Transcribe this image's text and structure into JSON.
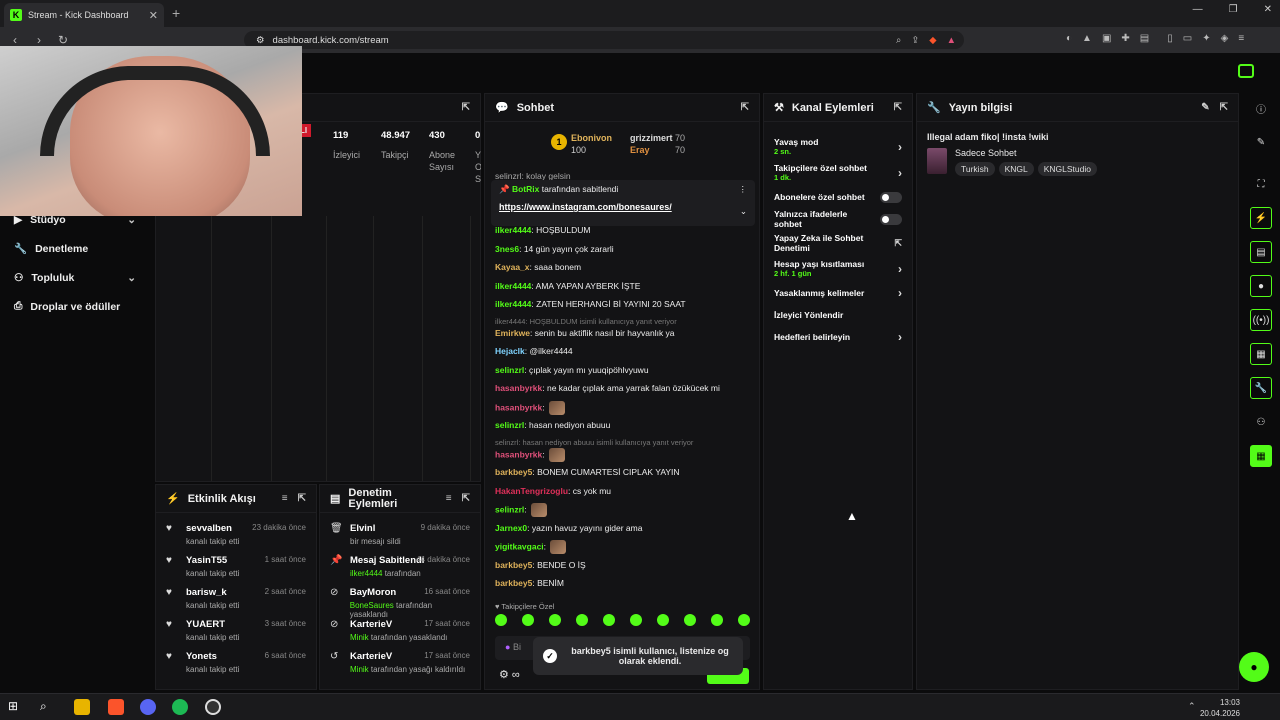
{
  "browser": {
    "tab_title": "Stream - Kick Dashboard",
    "url": "dashboard.kick.com/stream",
    "new_tab": "+",
    "close": "✕",
    "minimize": "—",
    "maximize": "❐"
  },
  "leftnav": {
    "items": [
      {
        "label": "Stüdyo",
        "icon": "video-icon",
        "chevron": "⌄"
      },
      {
        "label": "Denetleme",
        "icon": "wrench-icon"
      },
      {
        "label": "Topluluk",
        "icon": "people-icon",
        "chevron": "⌄"
      },
      {
        "label": "Droplar ve ödüller",
        "icon": "gift-icon"
      }
    ]
  },
  "stats": {
    "live_badge": "LI",
    "cols": [
      {
        "value": "119",
        "label": "İzleyici"
      },
      {
        "value": "48.947",
        "label": "Takipçi"
      },
      {
        "value": "430",
        "label": "Abone Sayısı"
      },
      {
        "value": "0",
        "label": "Y O S"
      }
    ]
  },
  "activity": {
    "title": "Etkinlik Akışı",
    "items": [
      {
        "name": "sevvalben",
        "sub": "kanalı takip etti",
        "time": "23 dakika önce"
      },
      {
        "name": "YasinT55",
        "sub": "kanalı takip etti",
        "time": "1 saat önce"
      },
      {
        "name": "barisw_k",
        "sub": "kanalı takip etti",
        "time": "2 saat önce"
      },
      {
        "name": "YUAERT",
        "sub": "kanalı takip etti",
        "time": "3 saat önce"
      },
      {
        "name": "Yonets",
        "sub": "kanalı takip etti",
        "time": "6 saat önce"
      }
    ]
  },
  "modactions": {
    "title": "Denetim Eylemleri",
    "items": [
      {
        "name": "Elvinl",
        "sub_user": "",
        "sub": "bir mesajı sildi",
        "time": "9 dakika önce",
        "icon": "🗑"
      },
      {
        "name": "Mesaj Sabitlendi",
        "sub_user": "ilker4444",
        "sub": "tarafından",
        "time": "44 dakika önce",
        "icon": "📌"
      },
      {
        "name": "BayMoron",
        "sub_user": "BoneSaures",
        "sub": "tarafından yasaklandı",
        "time": "16 saat önce",
        "icon": "⊘"
      },
      {
        "name": "KarterieV",
        "sub_user": "Minik",
        "sub": "tarafından yasaklandı",
        "time": "17 saat önce",
        "icon": "⊘"
      },
      {
        "name": "KarterieV",
        "sub_user": "Minik",
        "sub": "tarafından yasağı kaldırıldı",
        "time": "17 saat önce",
        "icon": "↺"
      }
    ]
  },
  "chat": {
    "title": "Sohbet",
    "top": {
      "user1": "Ebonivon",
      "user1_val": "100",
      "user2": "grizzimert",
      "user2_val": "70",
      "user3": "Eray",
      "user3_val": "70"
    },
    "partial_msg": "selinzrl: kolay gelsin",
    "pinned": {
      "by": "BotRix",
      "suffix": "tarafından sabitlendi",
      "link": "https://www.instagram.com/bonesaures/"
    },
    "messages": [
      {
        "user": "ilker4444",
        "color": "#53fc18",
        "text": ": HOŞBULDUM"
      },
      {
        "user": "3nes6",
        "color": "#53fc18",
        "text": ": 14 gün yayın çok zararli"
      },
      {
        "user": "Kayaa_x",
        "color": "#e0b35b",
        "text": ": saaa bonem"
      },
      {
        "user": "ilker4444",
        "color": "#53fc18",
        "text": ": AMA YAPAN AYBERK İŞTE"
      },
      {
        "user": "ilker4444",
        "color": "#53fc18",
        "text": ": ZATEN HERHANGİ Bİ YAYINI 20 SAAT"
      },
      {
        "reply": "ilker4444: HOŞBULDUM isimli kullanıcıya yanıt veriyor",
        "user": "Emirkwe",
        "color": "#e0b35b",
        "text": ": senin bu aktiflik nasıl bir hayvanlık ya"
      },
      {
        "user": "Hejaclk",
        "color": "#7fd3ff",
        "text": ": @ilker4444"
      },
      {
        "user": "selinzrl",
        "color": "#53fc18",
        "text": ": çıplak yayın mı yuuqipöhlvyuwu"
      },
      {
        "user": "hasanbyrkk",
        "color": "#e0507a",
        "text": ": ne kadar çıplak ama yarrak falan özükücek mi"
      },
      {
        "user": "hasanbyrkk",
        "color": "#e0507a",
        "text": ":",
        "emote": true
      },
      {
        "user": "selinzrl",
        "color": "#53fc18",
        "text": ": hasan nediyon abuuu"
      },
      {
        "reply": "selinzrl: hasan nediyon abuuu isimli kullanıcıya yanıt veriyor",
        "user": "hasanbyrkk",
        "color": "#e0507a",
        "text": ":",
        "emote": true
      },
      {
        "user": "barkbey5",
        "color": "#e0b35b",
        "text": ": BONEM CUMARTESİ CIPLAK YAYIN"
      },
      {
        "user": "HakanTengrizoglu",
        "color": "#e0305a",
        "text": ": cs yok mu"
      },
      {
        "user": "selinzrl",
        "color": "#53fc18",
        "text": ":",
        "emote": true
      },
      {
        "user": "Jarnex0",
        "color": "#53fc18",
        "text": ": yazın havuz yayını gider ama"
      },
      {
        "user": "yigitkavgaci",
        "color": "#53fc18",
        "text": ":",
        "emote": true
      },
      {
        "user": "barkbey5",
        "color": "#e0b35b",
        "text": ": BENDE O İŞ"
      },
      {
        "user": "barkbey5",
        "color": "#e0b35b",
        "text": ": BENİM"
      }
    ],
    "followers_only": "Takipçilere Özel",
    "input_placeholder": "Bi",
    "infinity": "∞"
  },
  "toast": {
    "text": "barkbey5 isimli kullanıcı, listenize og olarak eklendi."
  },
  "channel_actions": {
    "title": "Kanal Eylemleri",
    "rows": [
      {
        "label": "Yavaş mod",
        "sub": "2 sn.",
        "ctl": "chevron"
      },
      {
        "label": "Takipçilere özel sohbet",
        "sub": "1 dk.",
        "ctl": "chevron"
      },
      {
        "label": "Abonelere özel sohbet",
        "sub": "",
        "ctl": "toggle"
      },
      {
        "label": "Yalnızca ifadelerle sohbet",
        "sub": "",
        "ctl": "toggle"
      },
      {
        "label": "Yapay Zeka ile Sohbet Denetimi",
        "sub": "",
        "ctl": "external"
      },
      {
        "label": "Hesap yaşı kısıtlaması",
        "sub": "2 hf. 1 gün",
        "ctl": "chevron"
      },
      {
        "label": "Yasaklanmış kelimeler",
        "sub": "",
        "ctl": "chevron"
      },
      {
        "label": "İzleyici Yönlendir",
        "sub": "",
        "ctl": "none"
      },
      {
        "label": "Hedefleri belirleyin",
        "sub": "",
        "ctl": "chevron"
      }
    ]
  },
  "stream_info": {
    "title": "Yayın bilgisi",
    "stream_title": "Illegal adam fiko| !insta !wiki",
    "category": "Sadece Sohbet",
    "tags": [
      "Turkish",
      "KNGL",
      "KNGLStudio"
    ]
  },
  "taskbar": {
    "time": "13:03",
    "date": "20.04.2026"
  },
  "colors": {
    "accent": "#53fc18",
    "bg": "#0b0b0c",
    "panel": "#131315"
  }
}
